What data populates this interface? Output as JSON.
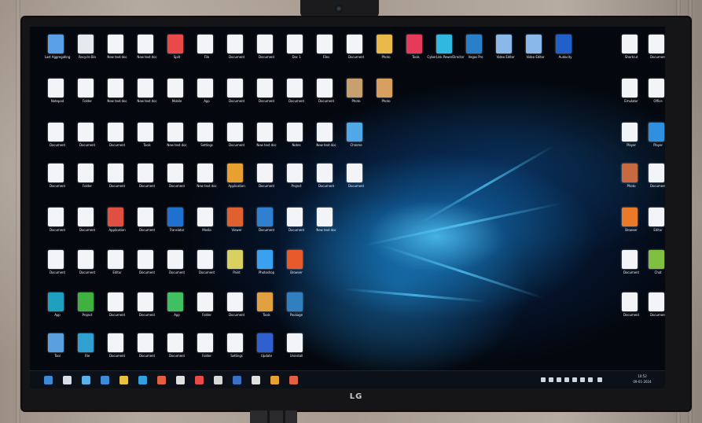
{
  "monitor": {
    "brand": "LG"
  },
  "desktop": {
    "icons": [
      {
        "label": "Last Aggregating",
        "color": "#5aa0e6"
      },
      {
        "label": "Recycle Bin",
        "color": "#e6e9ee"
      },
      {
        "label": "New text doc",
        "color": "#f2f4f8"
      },
      {
        "label": "New text doc",
        "color": "#f2f4f8"
      },
      {
        "label": "Split",
        "color": "#e84a4a"
      },
      {
        "label": "File",
        "color": "#f2f4f8"
      },
      {
        "label": "Document",
        "color": "#f2f4f8"
      },
      {
        "label": "Document",
        "color": "#f2f4f8"
      },
      {
        "label": "Doc 1",
        "color": "#f2f4f8"
      },
      {
        "label": "Files",
        "color": "#f2f4f8"
      },
      {
        "label": "Document",
        "color": "#f2f4f8"
      },
      {
        "label": "Photo",
        "color": "#e8b84a"
      },
      {
        "label": "Tools",
        "color": "#e63a5a"
      },
      {
        "label": "CyberLink PowerDirector",
        "color": "#30b8e0"
      },
      {
        "label": "Vegas Pro",
        "color": "#2a80c8"
      },
      {
        "label": "Video Editor",
        "color": "#8ab8e8"
      },
      {
        "label": "Video Editor",
        "color": "#8ab8e8"
      },
      {
        "label": "Audacity",
        "color": "#2060c8"
      },
      {
        "label": "Shortcut",
        "color": "#f2f4f8"
      },
      {
        "label": "Document",
        "color": "#f2f4f8"
      },
      {
        "label": "Notepad",
        "color": "#f2f4f8"
      },
      {
        "label": "Folder",
        "color": "#f2f4f8"
      },
      {
        "label": "New text doc",
        "color": "#f2f4f8"
      },
      {
        "label": "New text doc",
        "color": "#f2f4f8"
      },
      {
        "label": "Mobile",
        "color": "#f2f4f8"
      },
      {
        "label": "App",
        "color": "#f2f4f8"
      },
      {
        "label": "Document",
        "color": "#f2f4f8"
      },
      {
        "label": "Document",
        "color": "#f2f4f8"
      },
      {
        "label": "Document",
        "color": "#f2f4f8"
      },
      {
        "label": "Document",
        "color": "#f2f4f8"
      },
      {
        "label": "Photo",
        "color": "#c8a070"
      },
      {
        "label": "Photo",
        "color": "#d8a060"
      },
      {
        "label": "Emulator",
        "color": "#f2f4f8"
      },
      {
        "label": "Office",
        "color": "#f2f4f8"
      },
      {
        "label": "File",
        "color": "#f2f4f8"
      },
      {
        "label": "Downloader",
        "color": "#50c050"
      },
      {
        "label": "New text doc",
        "color": "#f2f4f8"
      },
      {
        "label": "New text doc",
        "color": "#f2f4f8"
      },
      {
        "label": "App",
        "color": "#40c040"
      },
      {
        "label": "Archive",
        "color": "#f2f4f8"
      },
      {
        "label": "Document",
        "color": "#f2f4f8"
      },
      {
        "label": "Document",
        "color": "#f2f4f8"
      },
      {
        "label": "Document",
        "color": "#f2f4f8"
      },
      {
        "label": "Tools",
        "color": "#f2f4f8"
      },
      {
        "label": "New text doc",
        "color": "#f2f4f8"
      },
      {
        "label": "Settings",
        "color": "#f2f4f8"
      },
      {
        "label": "Document",
        "color": "#f2f4f8"
      },
      {
        "label": "New text doc",
        "color": "#f2f4f8"
      },
      {
        "label": "Notes",
        "color": "#f2f4f8"
      },
      {
        "label": "New text doc",
        "color": "#f2f4f8"
      },
      {
        "label": "Chrome",
        "color": "#50a8e8"
      },
      {
        "label": "Player",
        "color": "#f2f4f8"
      },
      {
        "label": "Player",
        "color": "#3090e0"
      },
      {
        "label": "Document",
        "color": "#f2f4f8"
      },
      {
        "label": "Folder",
        "color": "#f2f4f8"
      },
      {
        "label": "Document",
        "color": "#f2f4f8"
      },
      {
        "label": "Document",
        "color": "#f2f4f8"
      },
      {
        "label": "Document",
        "color": "#f2f4f8"
      },
      {
        "label": "New text doc",
        "color": "#f2f4f8"
      },
      {
        "label": "Application",
        "color": "#e8a030"
      },
      {
        "label": "Document",
        "color": "#f2f4f8"
      },
      {
        "label": "Project",
        "color": "#f2f4f8"
      },
      {
        "label": "Document",
        "color": "#f2f4f8"
      },
      {
        "label": "Document",
        "color": "#f2f4f8"
      },
      {
        "label": "Photo",
        "color": "#c86a40"
      },
      {
        "label": "Document",
        "color": "#f2f4f8"
      },
      {
        "label": "Document",
        "color": "#f2f4f8"
      },
      {
        "label": "Document",
        "color": "#f2f4f8"
      },
      {
        "label": "Application",
        "color": "#e05040"
      },
      {
        "label": "Document",
        "color": "#f2f4f8"
      },
      {
        "label": "Translator",
        "color": "#2070d0"
      },
      {
        "label": "Media",
        "color": "#f2f4f8"
      },
      {
        "label": "Viewer",
        "color": "#e06030"
      },
      {
        "label": "Document",
        "color": "#3080d0"
      },
      {
        "label": "Document",
        "color": "#f2f4f8"
      },
      {
        "label": "New text doc",
        "color": "#f2f4f8"
      },
      {
        "label": "Browser",
        "color": "#e87a2a"
      },
      {
        "label": "Editor",
        "color": "#f2f4f8"
      },
      {
        "label": "Document",
        "color": "#f2f4f8"
      },
      {
        "label": "Document",
        "color": "#f2f4f8"
      },
      {
        "label": "Editor",
        "color": "#f2f4f8"
      },
      {
        "label": "Document",
        "color": "#f2f4f8"
      },
      {
        "label": "Document",
        "color": "#f2f4f8"
      },
      {
        "label": "Document",
        "color": "#f2f4f8"
      },
      {
        "label": "Paint",
        "color": "#d8d060"
      },
      {
        "label": "Photoshop",
        "color": "#3aa0f0"
      },
      {
        "label": "Browser",
        "color": "#e85a2a"
      },
      {
        "label": "Document",
        "color": "#f2f4f8"
      },
      {
        "label": "Chat",
        "color": "#80c040"
      },
      {
        "label": "App",
        "color": "#20a0c0"
      },
      {
        "label": "Project",
        "color": "#40b040"
      },
      {
        "label": "Document",
        "color": "#f2f4f8"
      },
      {
        "label": "Document",
        "color": "#f2f4f8"
      },
      {
        "label": "App",
        "color": "#40c060"
      },
      {
        "label": "Folder",
        "color": "#f2f4f8"
      },
      {
        "label": "Document",
        "color": "#f2f4f8"
      },
      {
        "label": "Tools",
        "color": "#e0a040"
      },
      {
        "label": "Package",
        "color": "#3080c0"
      },
      {
        "label": "Document",
        "color": "#f2f4f8"
      },
      {
        "label": "Document",
        "color": "#f2f4f8"
      },
      {
        "label": "Tool",
        "color": "#5aa0e0"
      },
      {
        "label": "File",
        "color": "#30a0d0"
      },
      {
        "label": "Document",
        "color": "#f2f4f8"
      },
      {
        "label": "Document",
        "color": "#f2f4f8"
      },
      {
        "label": "Document",
        "color": "#f2f4f8"
      },
      {
        "label": "Folder",
        "color": "#f2f4f8"
      },
      {
        "label": "Settings",
        "color": "#f2f4f8"
      },
      {
        "label": "Update",
        "color": "#3060d0"
      },
      {
        "label": "Uninstall",
        "color": "#f2f4f8"
      }
    ]
  },
  "taskbar": {
    "clock_time": "10:52",
    "clock_date": "09-01-2024",
    "buttons": [
      {
        "name": "start",
        "color": "#3a8ad8"
      },
      {
        "name": "search",
        "color": "#d8dee8"
      },
      {
        "name": "task-view",
        "color": "#5ab0e8"
      },
      {
        "name": "app",
        "color": "#3a8ad8"
      },
      {
        "name": "app",
        "color": "#e8c040"
      },
      {
        "name": "app",
        "color": "#30a0e0"
      },
      {
        "name": "app",
        "color": "#e06040"
      },
      {
        "name": "app",
        "color": "#e0e0e0"
      },
      {
        "name": "app",
        "color": "#e84a4a"
      },
      {
        "name": "app",
        "color": "#d8d8d8"
      },
      {
        "name": "app",
        "color": "#3a70c8"
      },
      {
        "name": "app",
        "color": "#e0e0e0"
      },
      {
        "name": "app",
        "color": "#e8a030"
      },
      {
        "name": "app",
        "color": "#e06040"
      }
    ]
  }
}
